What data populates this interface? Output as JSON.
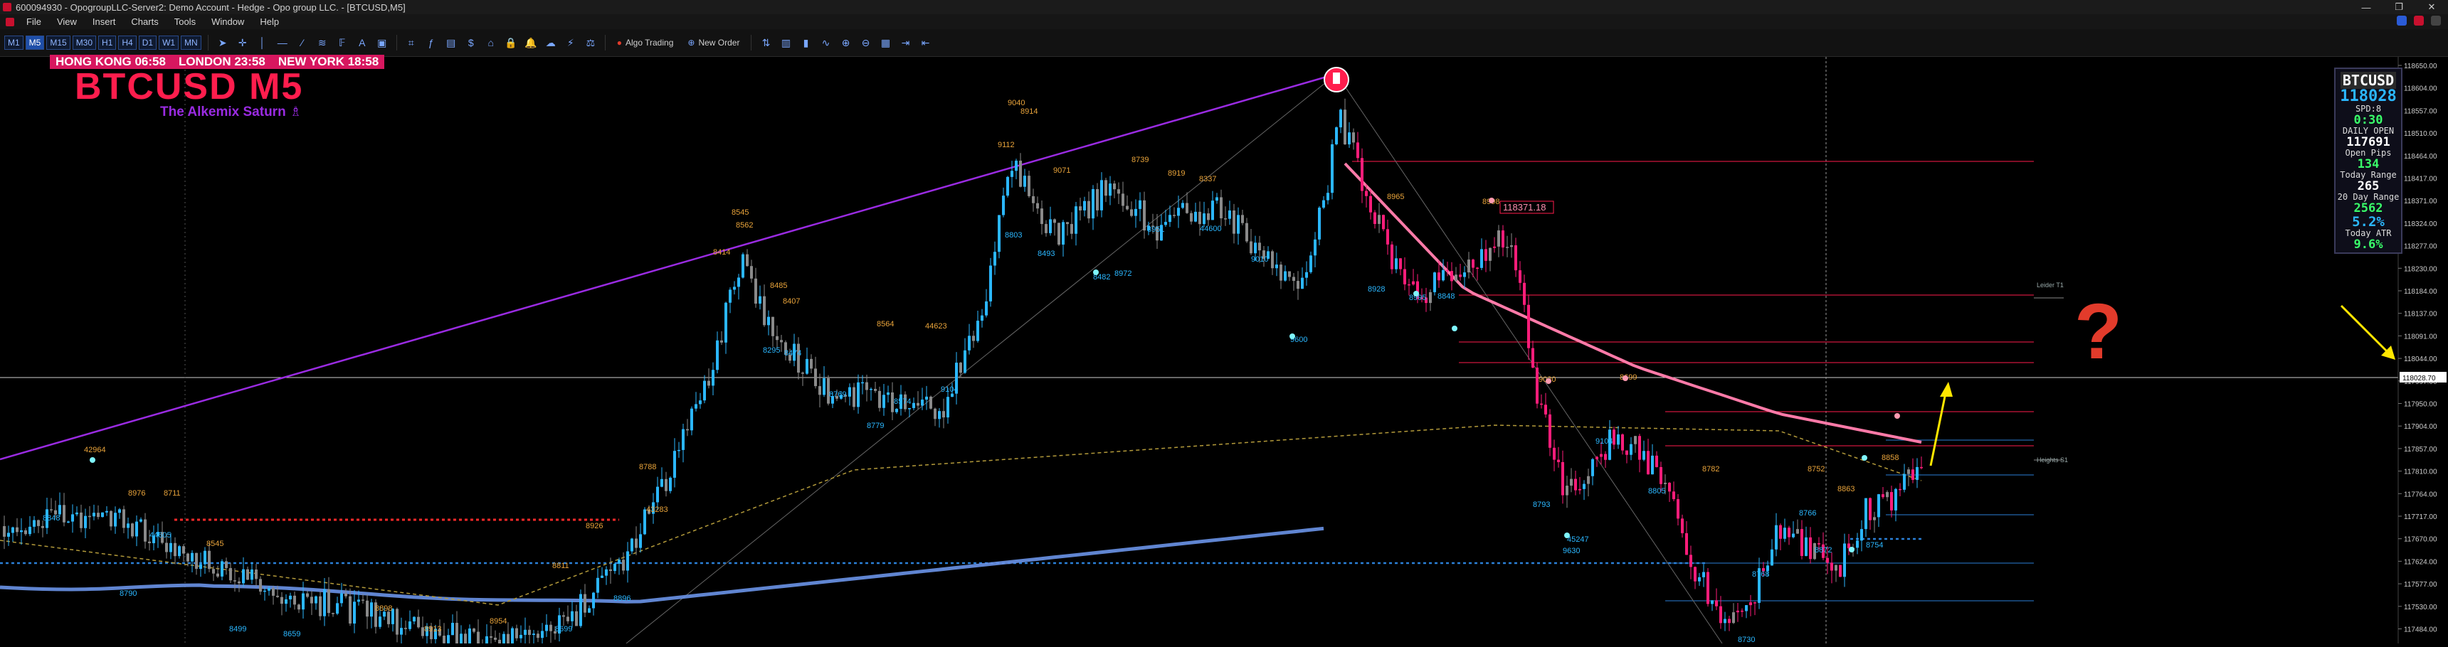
{
  "window": {
    "title": "600094930 - OpogroupLLC-Server2: Demo Account - Hedge - Opo group LLC. - [BTCUSD,M5]",
    "buttons": [
      "—",
      "❐",
      "✕"
    ]
  },
  "menu": [
    "File",
    "View",
    "Insert",
    "Charts",
    "Tools",
    "Window",
    "Help"
  ],
  "toolbar": {
    "timeframes": [
      "M1",
      "M5",
      "M15",
      "M30",
      "H1",
      "H4",
      "D1",
      "W1",
      "MN"
    ],
    "active_timeframe": "M5",
    "algo_trading": "Algo Trading",
    "new_order": "New Order"
  },
  "sessions": {
    "hong_kong": "HONG KONG 06:58",
    "london": "LONDON  23:58",
    "new_york": "NEW YORK  18:58"
  },
  "symbol_title": "BTCUSD M5",
  "indicator_subtitle": "The Alkemix Saturn ♗",
  "panel": {
    "symbol": "BTCUSD",
    "price": "118028",
    "spread": "SPD:8",
    "spread_value": "0:30",
    "daily_open_label": "DAILY OPEN",
    "daily_open": "117691",
    "open_pips_label": "Open Pips",
    "open_pips": "134",
    "today_range_label": "Today Range",
    "today_range": "265",
    "twenty_day_label": "20 Day Range",
    "twenty_day": "2562",
    "twenty_day_pct": "5.2%",
    "today_atr_label": "Today ATR",
    "today_atr": "9.6%"
  },
  "price_labels": {
    "box": "118371.18",
    "current": "118028.70",
    "upper_line": "Leider T1",
    "mid_line": "Heights S1"
  },
  "annotations": [
    "42964",
    "8848",
    "8976",
    "8711",
    "44605",
    "8545",
    "8790",
    "8499",
    "8659",
    "8898",
    "8913",
    "8954",
    "8811",
    "8926",
    "8896",
    "8699",
    "43283",
    "8788",
    "8545",
    "8414",
    "8562",
    "8407",
    "8295",
    "8474",
    "8485",
    "8769",
    "8779",
    "8564",
    "8574",
    "44623",
    "9104",
    "9040",
    "8914",
    "9112",
    "9071",
    "8803",
    "8493",
    "8739",
    "8919",
    "8337",
    "8482",
    "8972",
    "8951",
    "44600",
    "9010",
    "9600",
    "8965",
    "8928",
    "8995",
    "8848",
    "8998",
    "9020",
    "8699",
    "9104",
    "45247",
    "9630",
    "8793",
    "8782",
    "8752",
    "8766",
    "8768",
    "8730",
    "8863",
    "8872",
    "8754",
    "8805",
    "8858"
  ],
  "axis_ticks": [
    "118650.00",
    "118604.00",
    "118557.00",
    "118510.00",
    "118464.00",
    "118417.00",
    "118371.00",
    "118324.00",
    "118277.00",
    "118230.00",
    "118184.00",
    "118137.00",
    "118091.00",
    "118044.00",
    "117997.00",
    "117950.00",
    "117904.00",
    "117857.00",
    "117810.00",
    "117764.00",
    "117717.00",
    "117670.00",
    "117624.00",
    "117577.00",
    "117530.00",
    "117484.00"
  ],
  "colors": {
    "up_candle": "#2bb7ff",
    "down_candle": "#ff1d7a",
    "neutral_candle": "#8a8a8a",
    "trendline": "#9a2be2",
    "ma_long": "#6a93e8",
    "ma_pink": "#ff7aa8",
    "ma_dash": "#b39a3a"
  },
  "icons": [
    "question-mark-icon",
    "yellow-arrow-icon",
    "sell-marker-icon"
  ]
}
